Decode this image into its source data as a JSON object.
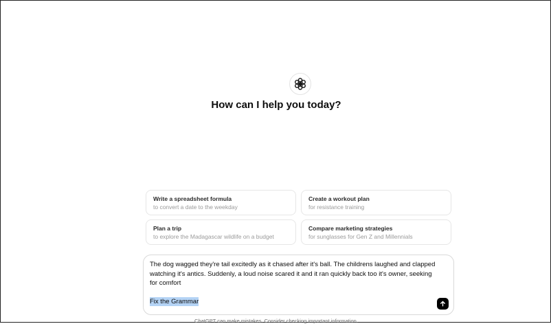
{
  "headline": "How can I help you today?",
  "suggestions": [
    {
      "title": "Write a spreadsheet formula",
      "subtitle": "to convert a date to the weekday"
    },
    {
      "title": "Create a workout plan",
      "subtitle": "for resistance training"
    },
    {
      "title": "Plan a trip",
      "subtitle": "to explore the Madagascar wildlife on a budget"
    },
    {
      "title": "Compare marketing strategies",
      "subtitle": "for sunglasses for Gen Z and Millennials"
    }
  ],
  "composer": {
    "text": "The dog wagged they're tail excitedly as it chased after it's ball. The childrens laughed and clapped watching it's antics. Suddenly, a loud noise scared it and it ran quickly back too it's owner, seeking for comfort",
    "instruction": "Fix the Grammar"
  },
  "footer": "ChatGPT can make mistakes. Consider checking important information.",
  "icons": {
    "logo": "openai-logo-icon",
    "send": "arrow-up-icon"
  },
  "colors": {
    "send_button": "#000000",
    "selection_highlight": "#b4d3f5"
  }
}
